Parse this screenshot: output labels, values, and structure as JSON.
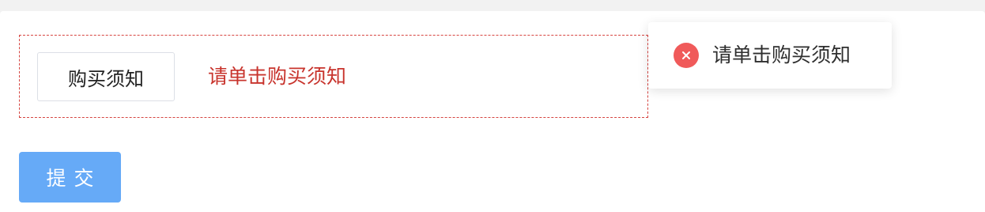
{
  "form": {
    "notice_button_label": "购买须知",
    "error_message": "请单击购买须知",
    "submit_label": "提交"
  },
  "toast": {
    "message": "请单击购买须知",
    "icon": "close-circle-icon",
    "icon_color": "#f05a5a"
  },
  "colors": {
    "error": "#c8342d",
    "primary": "#66aaf7",
    "dashed_border": "#d64541"
  }
}
